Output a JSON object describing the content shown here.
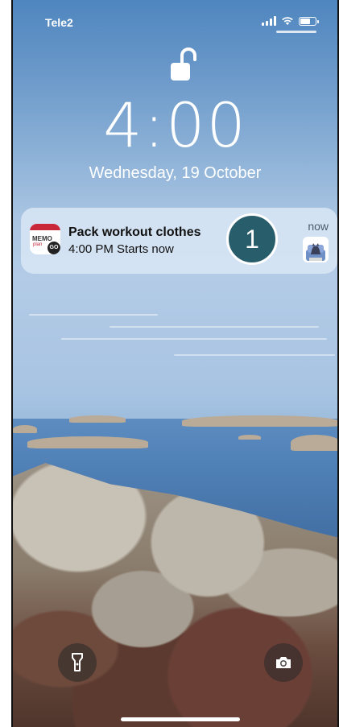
{
  "status_bar": {
    "carrier": "Tele2",
    "icons": [
      "signal-icon",
      "wifi-icon",
      "battery-icon"
    ]
  },
  "lock_screen": {
    "lock_icon": "unlocked-padlock-icon",
    "time": "4:00",
    "date": "Wednesday, 19 October"
  },
  "notification": {
    "app_icon": "memo-planner-go-app-icon",
    "app_icon_text": "MEMO",
    "app_icon_sub": "plan",
    "app_icon_badge": "GO",
    "title": "Pack workout clothes",
    "body": "4:00 PM Starts now",
    "time": "now",
    "thumbnail": "cat-in-chair-image",
    "step_badge": "1",
    "colors": {
      "badge": "#285e6b"
    }
  },
  "quick_actions": {
    "flashlight": "flashlight-icon",
    "camera": "camera-icon"
  }
}
